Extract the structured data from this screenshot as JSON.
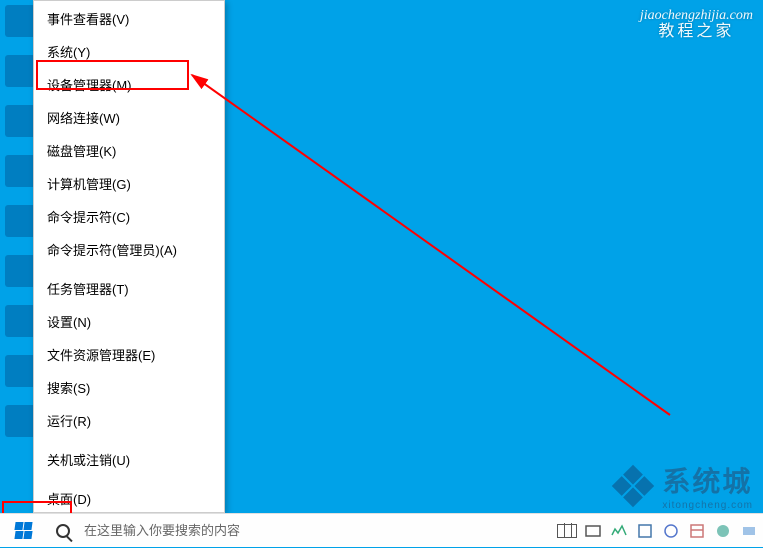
{
  "menu": {
    "items": [
      "事件查看器(V)",
      "系统(Y)",
      "设备管理器(M)",
      "网络连接(W)",
      "磁盘管理(K)",
      "计算机管理(G)",
      "命令提示符(C)",
      "命令提示符(管理员)(A)",
      "任务管理器(T)",
      "设置(N)",
      "文件资源管理器(E)",
      "搜索(S)",
      "运行(R)",
      "关机或注销(U)",
      "桌面(D)"
    ]
  },
  "taskbar": {
    "search_placeholder": "在这里输入你要搜索的内容"
  },
  "watermark_top": {
    "url": "jiaochengzhijia.com",
    "cn": "教程之家"
  },
  "watermark_bottom": {
    "text": "系统城",
    "sub": "xitongcheng.com"
  }
}
